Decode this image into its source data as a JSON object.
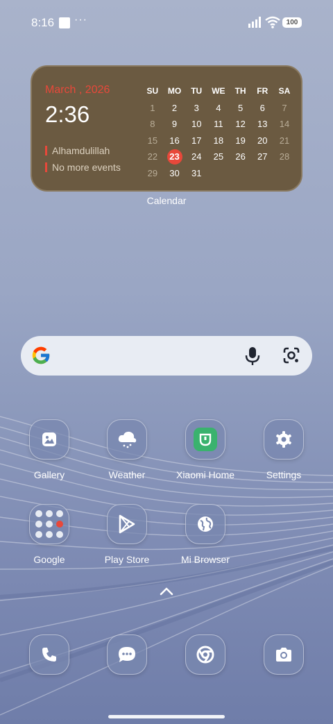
{
  "status": {
    "time": "8:16",
    "dots": "···",
    "battery": "100"
  },
  "calendar": {
    "month": "March , 2026",
    "clock": "2:36",
    "events": [
      "Alhamdulillah",
      "No more events"
    ],
    "weekdays": [
      "SU",
      "MO",
      "TU",
      "WE",
      "TH",
      "FR",
      "SA"
    ],
    "weeks": [
      [
        "1",
        "2",
        "3",
        "4",
        "5",
        "6",
        "7"
      ],
      [
        "8",
        "9",
        "10",
        "11",
        "12",
        "13",
        "14"
      ],
      [
        "15",
        "16",
        "17",
        "18",
        "19",
        "20",
        "21"
      ],
      [
        "22",
        "23",
        "24",
        "25",
        "26",
        "27",
        "28"
      ],
      [
        "29",
        "30",
        "31",
        "",
        "",
        "",
        ""
      ]
    ],
    "today": "23",
    "label": "Calendar"
  },
  "apps": {
    "row1": [
      "Gallery",
      "Weather",
      "Xiaomi Home",
      "Settings"
    ],
    "row2": [
      "Google",
      "Play Store",
      "Mi Browser"
    ]
  },
  "dock": [
    "phone-icon",
    "messages-icon",
    "chrome-icon",
    "camera-icon"
  ],
  "colors": {
    "accent": "#e8483a",
    "widget_bg": "#6b5a41"
  }
}
